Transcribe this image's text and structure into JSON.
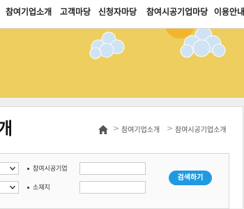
{
  "nav": {
    "items": [
      {
        "label": "참여기업소개"
      },
      {
        "label": "고객마당"
      },
      {
        "label": "신청자마당"
      },
      {
        "label": "참여시공기업마당"
      },
      {
        "label": "이용안내"
      }
    ]
  },
  "page": {
    "title": "개"
  },
  "breadcrumb": {
    "home_icon": "home-icon",
    "separator": ">",
    "items": [
      "참여기업소개",
      "참여시공기업소개"
    ]
  },
  "search": {
    "fields": [
      {
        "label": "참여시공기업",
        "value": ""
      },
      {
        "label": "소재지",
        "value": ""
      }
    ],
    "button_label": "검색하기"
  },
  "colors": {
    "banner": "#edce5e",
    "search_button": "#1f9ae0",
    "sun": "#f3b52b"
  }
}
